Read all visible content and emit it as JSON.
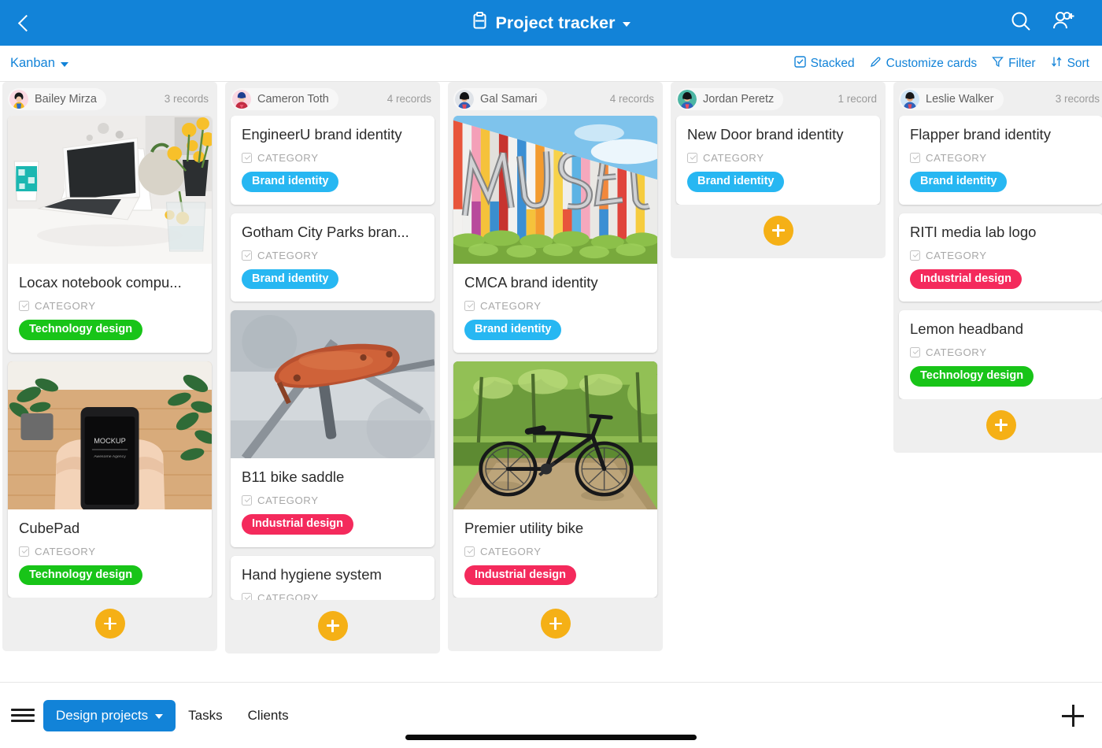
{
  "header": {
    "back_icon": "chevron-left-icon",
    "title": "Project tracker",
    "title_icon": "base-icon",
    "dropdown_icon": "caret-down-icon",
    "search_icon": "search-icon",
    "add_collaborator_icon": "add-user-icon",
    "background_color": "#1283d8"
  },
  "toolbar": {
    "view_name": "Kanban",
    "actions": [
      {
        "label": "Stacked",
        "icon": "stacked-checkbox-icon"
      },
      {
        "label": "Customize cards",
        "icon": "pencil-icon"
      },
      {
        "label": "Filter",
        "icon": "funnel-icon"
      },
      {
        "label": "Sort",
        "icon": "sort-arrows-icon"
      }
    ],
    "accent_color": "#1283d8"
  },
  "badge_colors": {
    "Brand identity": "#27b7f2",
    "Industrial design": "#f42a5c",
    "Technology design": "#18c418"
  },
  "card_field_label": "CATEGORY",
  "add_record_icon": "plus-circle-icon",
  "columns": [
    {
      "name": "Bailey Mirza",
      "count": "3 records",
      "avatar": "avatar-bailey-mirza",
      "cards": [
        {
          "title": "Locax notebook compu...",
          "field": "CATEGORY",
          "badge": "Technology design",
          "image": "laptop-desk-photo"
        },
        {
          "title": "CubePad",
          "field": "CATEGORY",
          "badge": "Technology design",
          "image": "phone-mockup-photo"
        }
      ]
    },
    {
      "name": "Cameron Toth",
      "count": "4 records",
      "avatar": "avatar-cameron-toth",
      "cards": [
        {
          "title": "EngineerU brand identity",
          "field": "CATEGORY",
          "badge": "Brand identity",
          "image": null
        },
        {
          "title": "Gotham City Parks bran...",
          "field": "CATEGORY",
          "badge": "Brand identity",
          "image": null
        },
        {
          "title": "B11 bike saddle",
          "field": "CATEGORY",
          "badge": "Industrial design",
          "image": "bike-saddle-photo"
        },
        {
          "title": "Hand hygiene system",
          "field": "CATEGORY",
          "badge": "",
          "image": null,
          "clipped": true
        }
      ]
    },
    {
      "name": "Gal Samari",
      "count": "4 records",
      "avatar": "avatar-gal-samari",
      "cards": [
        {
          "title": "CMCA brand identity",
          "field": "CATEGORY",
          "badge": "Brand identity",
          "image": "museum-facade-photo"
        },
        {
          "title": "Premier utility bike",
          "field": "CATEGORY",
          "badge": "Industrial design",
          "image": "bicycle-forest-photo"
        }
      ]
    },
    {
      "name": "Jordan Peretz",
      "count": "1 record",
      "avatar": "avatar-jordan-peretz",
      "cards": [
        {
          "title": "New Door brand identity",
          "field": "CATEGORY",
          "badge": "Brand identity",
          "image": null
        }
      ]
    },
    {
      "name": "Leslie Walker",
      "count": "3 records",
      "avatar": "avatar-leslie-walker",
      "cards": [
        {
          "title": "Flapper brand identity",
          "field": "CATEGORY",
          "badge": "Brand identity",
          "image": null
        },
        {
          "title": "RITI media lab logo",
          "field": "CATEGORY",
          "badge": "Industrial design",
          "image": null
        },
        {
          "title": "Lemon headband",
          "field": "CATEGORY",
          "badge": "Technology design",
          "image": null
        }
      ]
    }
  ],
  "bottombar": {
    "menu_icon": "hamburger-icon",
    "tabs": [
      {
        "label": "Design projects",
        "active": true,
        "has_caret": true
      },
      {
        "label": "Tasks",
        "active": false,
        "has_caret": false
      },
      {
        "label": "Clients",
        "active": false,
        "has_caret": false
      }
    ],
    "add_icon": "plus-icon",
    "active_color": "#1283d8"
  }
}
